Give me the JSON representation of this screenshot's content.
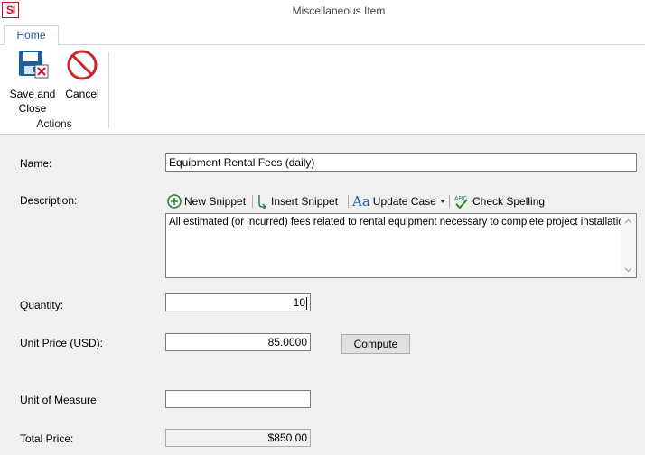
{
  "window": {
    "logo_text": "SI",
    "title": "Miscellaneous Item"
  },
  "ribbon": {
    "tabs": [
      {
        "label": "Home",
        "active": true
      }
    ],
    "save_close_label_line1": "Save and",
    "save_close_label_line2": "Close",
    "cancel_label": "Cancel",
    "group_label": "Actions"
  },
  "form": {
    "name_label": "Name:",
    "name_value": "Equipment Rental Fees (daily)",
    "description_label": "Description:",
    "toolbar": {
      "new_snippet": "New Snippet",
      "insert_snippet": "Insert Snippet",
      "update_case": "Update Case",
      "check_spelling": "Check Spelling"
    },
    "description_value": "All estimated (or incurred) fees related to rental equipment necessary to complete project installation.",
    "quantity_label": "Quantity:",
    "quantity_value": "10",
    "unit_price_label": "Unit Price (USD):",
    "unit_price_value": "85.0000",
    "compute_label": "Compute",
    "uom_label": "Unit of Measure:",
    "uom_value": "",
    "total_price_label": "Total Price:",
    "total_price_value": "$850.00"
  },
  "colors": {
    "brand_red": "#c8102e",
    "save_blue": "#1f5f9e",
    "tab_text": "#2b579a",
    "cancel_red": "#c62828",
    "snippet_green": "#2e7d32"
  }
}
